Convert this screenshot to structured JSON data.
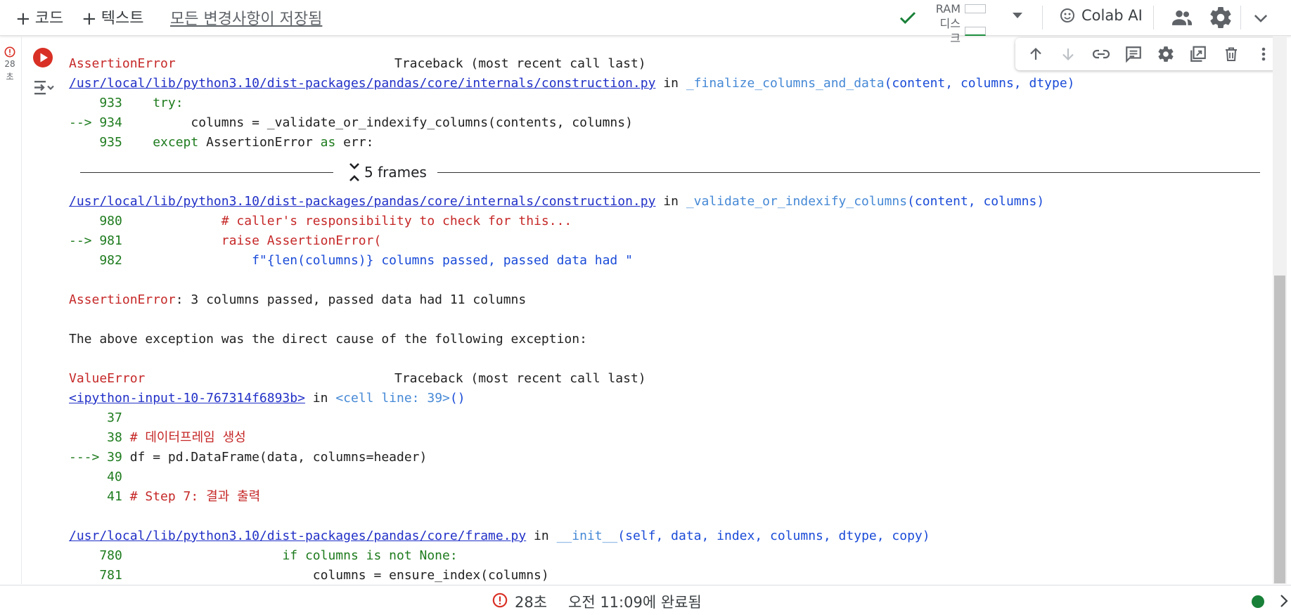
{
  "toolbar": {
    "add_code_label": "코드",
    "add_text_label": "텍스트",
    "save_status": "모든 변경사항이 저장됨",
    "ram_label": "RAM",
    "disk_label": "디스크",
    "colab_ai_label": "Colab AI"
  },
  "gutter": {
    "exec_time_num": "28",
    "exec_time_unit": "초"
  },
  "output": {
    "tb1_exception": "AssertionError",
    "tb1_header": "Traceback (most recent call last)",
    "tb1_file_link": "/usr/local/lib/python3.10/dist-packages/pandas/core/internals/construction.py",
    "tb1_in": " in ",
    "tb1_func": "_finalize_columns_and_data",
    "tb1_args": "(content, columns, dtype)",
    "l933_num": "    933 ",
    "l933_code": "   try:",
    "l934_arrow": "--> 934 ",
    "l934_code": "        columns = _validate_or_indexify_columns(contents, columns)",
    "l935_num": "    935 ",
    "l935_kw": "   except",
    "l935_code": " AssertionError ",
    "l935_as": "as",
    "l935_rest": " err:",
    "frames_label": "5 frames",
    "tb2_file_link": "/usr/local/lib/python3.10/dist-packages/pandas/core/internals/construction.py",
    "tb2_in": " in ",
    "tb2_func": "_validate_or_indexify_columns",
    "tb2_args": "(content, columns)",
    "l980_num": "    980 ",
    "l980_code": "            # caller's responsibility to check for this...",
    "l981_arrow": "--> 981 ",
    "l981_code": "            raise AssertionError(",
    "l982_num": "    982 ",
    "l982_code": "                f\"{len(columns)} columns passed, passed data had \"",
    "assert_name": "AssertionError",
    "assert_msg": ": 3 columns passed, passed data had 11 columns",
    "cause_msg": "The above exception was the direct cause of the following exception:",
    "tb3_exception": "ValueError",
    "tb3_header": "Traceback (most recent call last)",
    "tb3_link": "<ipython-input-10-767314f6893b>",
    "tb3_in": " in ",
    "tb3_cell": "<cell line: 39>",
    "tb3_paren": "()",
    "l37_num": "     37 ",
    "l38_num": "     38 ",
    "l38_code": "# 데이터프레임 생성",
    "l39_arrow": "---> 39 ",
    "l39_code": "df = pd.DataFrame(data, columns=header)",
    "l40_num": "     40 ",
    "l41_num": "     41 ",
    "l41_code": "# Step 7: 결과 출력",
    "tb4_file_link": "/usr/local/lib/python3.10/dist-packages/pandas/core/frame.py",
    "tb4_in": " in ",
    "tb4_func": "__init__",
    "tb4_args": "(self, data, index, columns, dtype, copy)",
    "l780_num": "    780 ",
    "l780_code": "                    if columns is not None:",
    "l781_num": "    781 ",
    "l781_code": "                        columns = ensure_index(columns)"
  },
  "statusbar": {
    "exec_time": "28초",
    "completed": "오전 11:09에 완료됨"
  },
  "colors": {
    "error_red": "#d93025",
    "ok_green": "#188038",
    "link_blue": "#2130c7"
  }
}
